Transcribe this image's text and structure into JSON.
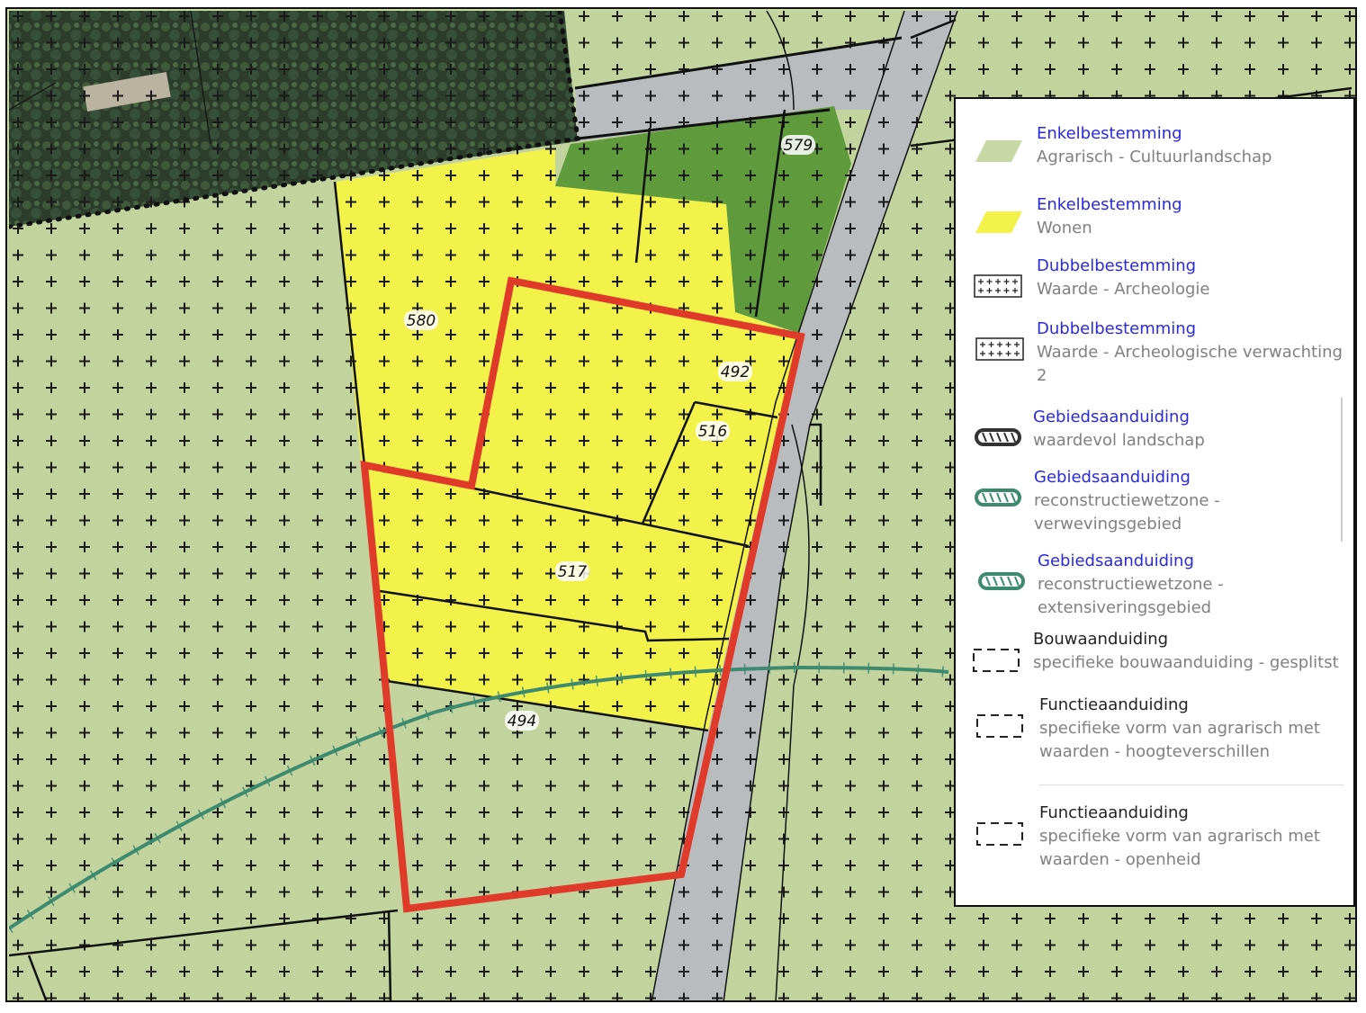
{
  "map": {
    "plot_numbers": [
      "579",
      "580",
      "492",
      "516",
      "517",
      "494"
    ],
    "colors": {
      "agrarisch": "#c8d8a4",
      "wonen": "#f2f24a",
      "bos": "#5f9a3c",
      "weg": "#b9bcbf",
      "plangebied": "#e03a2a",
      "landschap_lijn": "#3d8a6e"
    }
  },
  "legend": {
    "items": [
      {
        "icon": "parallelogram-light-green",
        "title": "Enkelbestemming",
        "subtitle": "Agrarisch - Cultuurlandschap"
      },
      {
        "icon": "parallelogram-yellow",
        "title": "Enkelbestemming",
        "subtitle": "Wonen"
      },
      {
        "icon": "plus-grid-box",
        "title": "Dubbelbestemming",
        "subtitle": "Waarde - Archeologie"
      },
      {
        "icon": "plus-grid-box",
        "title": "Dubbelbestemming",
        "subtitle": "Waarde - Archeologische verwachting 2"
      },
      {
        "icon": "scalloped-outline-dark",
        "title": "Gebiedsaanduiding",
        "subtitle": "waardevol landschap"
      },
      {
        "icon": "scalloped-outline-green",
        "title": "Gebiedsaanduiding",
        "subtitle": "reconstructiewetzone - verwevingsgebied"
      },
      {
        "icon": "scalloped-outline-green",
        "title": "Gebiedsaanduiding",
        "subtitle": "reconstructiewetzone - extensiveringsgebied"
      },
      {
        "icon": "dashed-box",
        "title": "Bouwaanduiding",
        "subtitle": "specifieke bouwaanduiding - gesplitst"
      },
      {
        "icon": "dashed-box",
        "title": "Functieaanduiding",
        "subtitle": "specifieke vorm van agrarisch met waarden - hoogteverschillen"
      },
      {
        "icon": "dashed-box",
        "title": "Functieaanduiding",
        "subtitle": "specifieke vorm van agrarisch met waarden - openheid"
      }
    ]
  }
}
